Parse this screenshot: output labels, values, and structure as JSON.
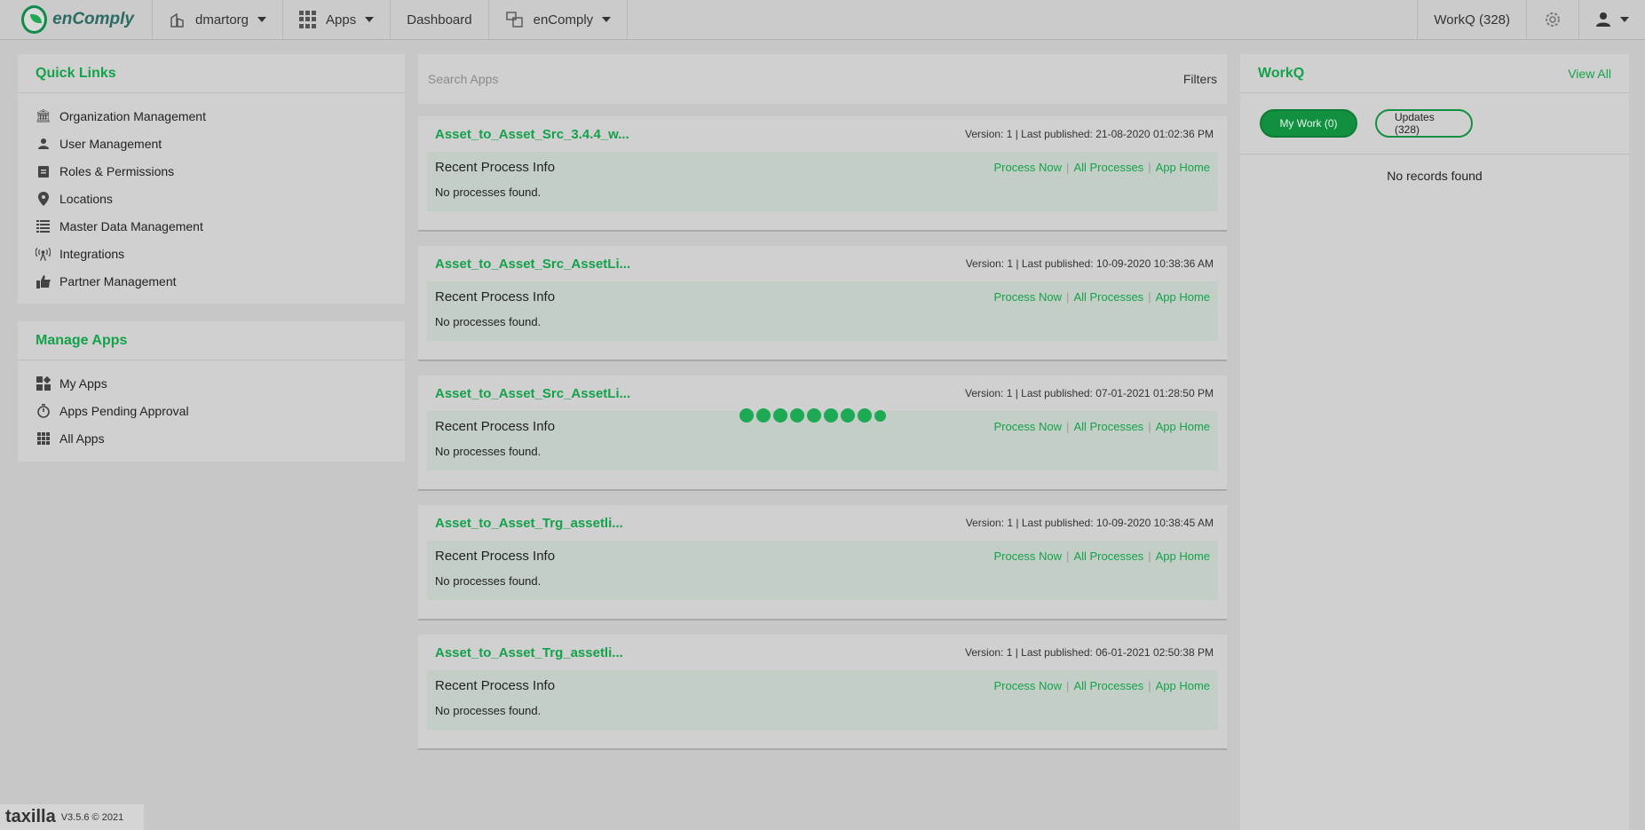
{
  "topbar": {
    "brand": "enComply",
    "org": "dmartorg",
    "apps_label": "Apps",
    "dashboard_label": "Dashboard",
    "product_label": "enComply",
    "workq_label": "WorkQ (328)"
  },
  "quick_links": {
    "title": "Quick Links",
    "items": [
      {
        "label": "Organization Management",
        "icon": "bank-icon"
      },
      {
        "label": "User Management",
        "icon": "user-icon"
      },
      {
        "label": "Roles & Permissions",
        "icon": "clipboard-icon"
      },
      {
        "label": "Locations",
        "icon": "location-pin-icon"
      },
      {
        "label": "Master Data Management",
        "icon": "table-icon"
      },
      {
        "label": "Integrations",
        "icon": "broadcast-icon"
      },
      {
        "label": "Partner Management",
        "icon": "thumbs-up-icon"
      }
    ]
  },
  "manage_apps": {
    "title": "Manage Apps",
    "items": [
      {
        "label": "My Apps",
        "icon": "widgets-icon"
      },
      {
        "label": "Apps Pending Approval",
        "icon": "timer-icon"
      },
      {
        "label": "All Apps",
        "icon": "grid-icon"
      }
    ]
  },
  "search": {
    "placeholder": "Search Apps",
    "filters_label": "Filters"
  },
  "apps": [
    {
      "name": "Asset_to_Asset_Src_3.4.4_w...",
      "meta": "Version: 1 | Last published: 21-08-2020 01:02:36 PM"
    },
    {
      "name": "Asset_to_Asset_Src_AssetLi...",
      "meta": "Version: 1 | Last published: 10-09-2020 10:38:36 AM"
    },
    {
      "name": "Asset_to_Asset_Src_AssetLi...",
      "meta": "Version: 1 | Last published: 07-01-2021 01:28:50 PM"
    },
    {
      "name": "Asset_to_Asset_Trg_assetli...",
      "meta": "Version: 1 | Last published: 10-09-2020 10:38:45 AM"
    },
    {
      "name": "Asset_to_Asset_Trg_assetli...",
      "meta": "Version: 1 | Last published: 06-01-2021 02:50:38 PM"
    }
  ],
  "app_card": {
    "recent_title": "Recent Process Info",
    "process_now": "Process Now",
    "all_processes": "All Processes",
    "app_home": "App Home",
    "empty": "No processes found.",
    "sep": "|"
  },
  "workq": {
    "title": "WorkQ",
    "view_all": "View All",
    "my_work": "My Work (0)",
    "updates": "Updates (328)",
    "empty": "No records found"
  },
  "footer": {
    "brand": "taxilla",
    "version": "V3.5.6 © 2021"
  },
  "colors": {
    "accent": "#13a24a",
    "background": "#c7c7c7"
  }
}
